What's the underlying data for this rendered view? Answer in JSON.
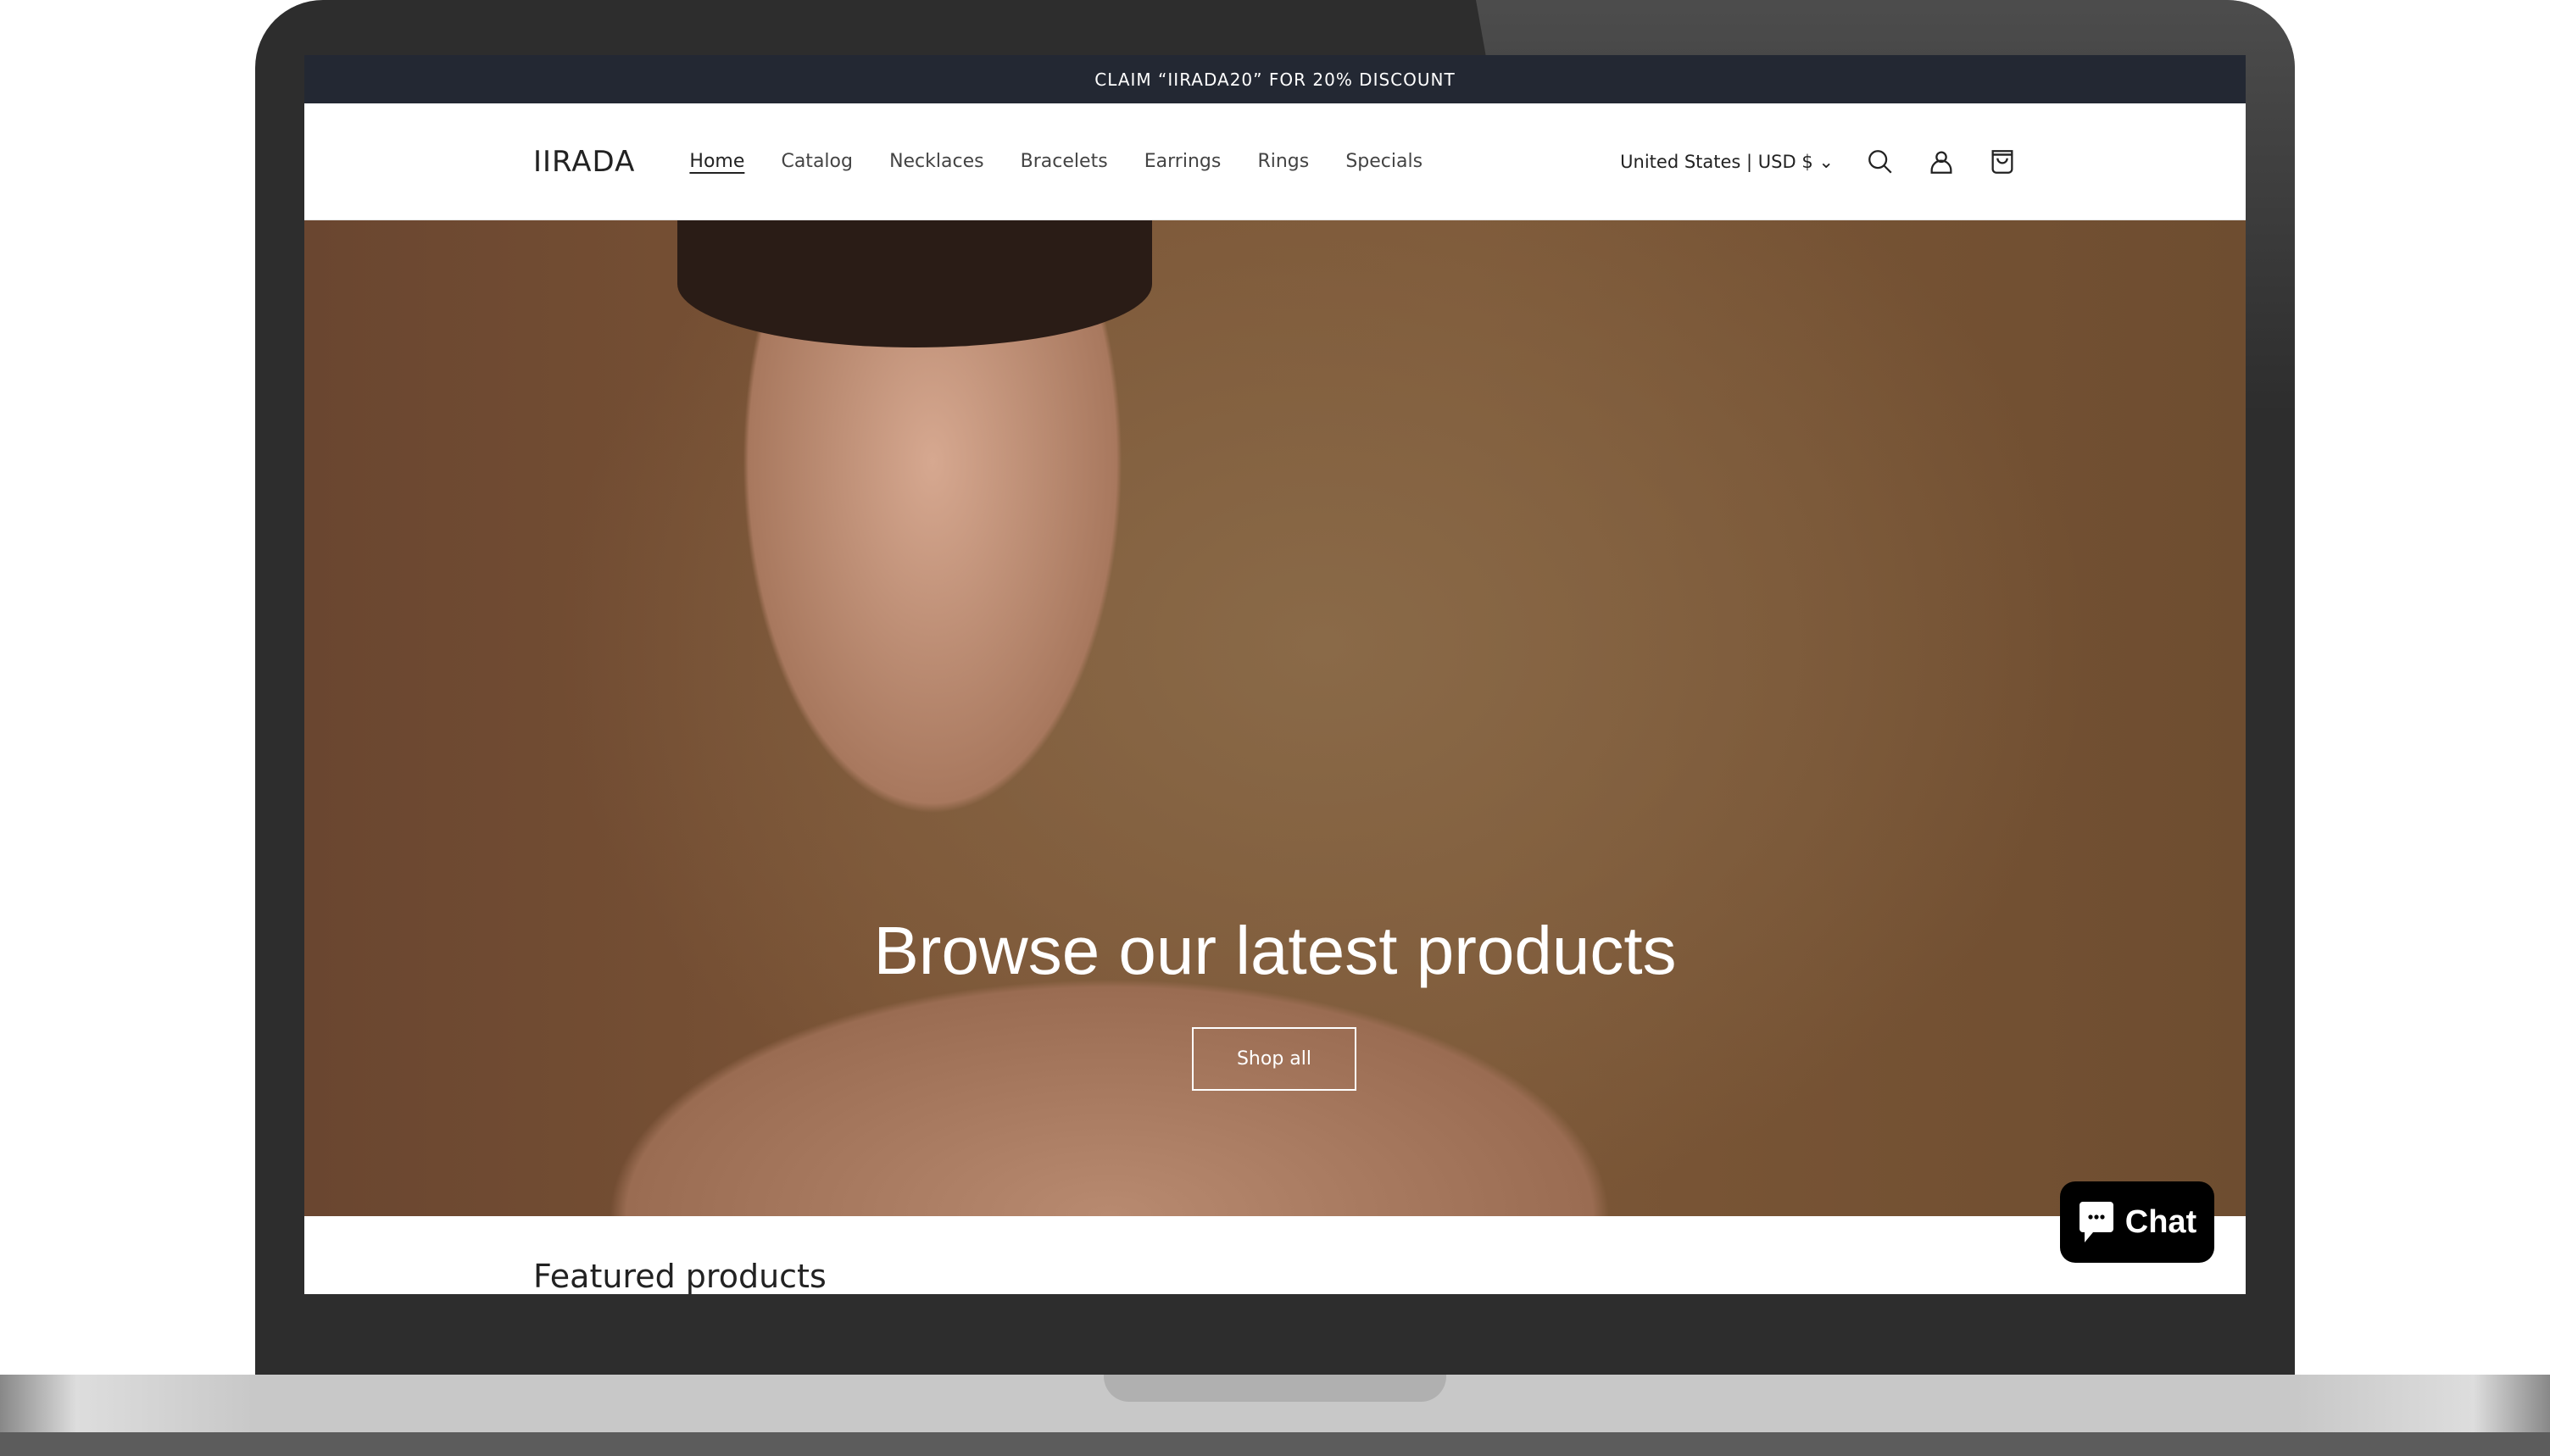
{
  "announcement": "CLAIM “IIRADA20” FOR 20% DISCOUNT",
  "header": {
    "logo": "IIRADA",
    "nav": [
      "Home",
      "Catalog",
      "Necklaces",
      "Bracelets",
      "Earrings",
      "Rings",
      "Specials"
    ],
    "active": "Home",
    "locale": "United States | USD $",
    "icons": [
      "search-icon",
      "account-icon",
      "cart-icon"
    ]
  },
  "hero": {
    "title": "Browse our latest products",
    "button": "Shop all"
  },
  "featured_heading": "Featured products",
  "chat": {
    "label": "Chat"
  },
  "colors": {
    "announcement_bg": "#232833",
    "hero_bg": "#7a5335",
    "chat_bg": "#000000"
  }
}
